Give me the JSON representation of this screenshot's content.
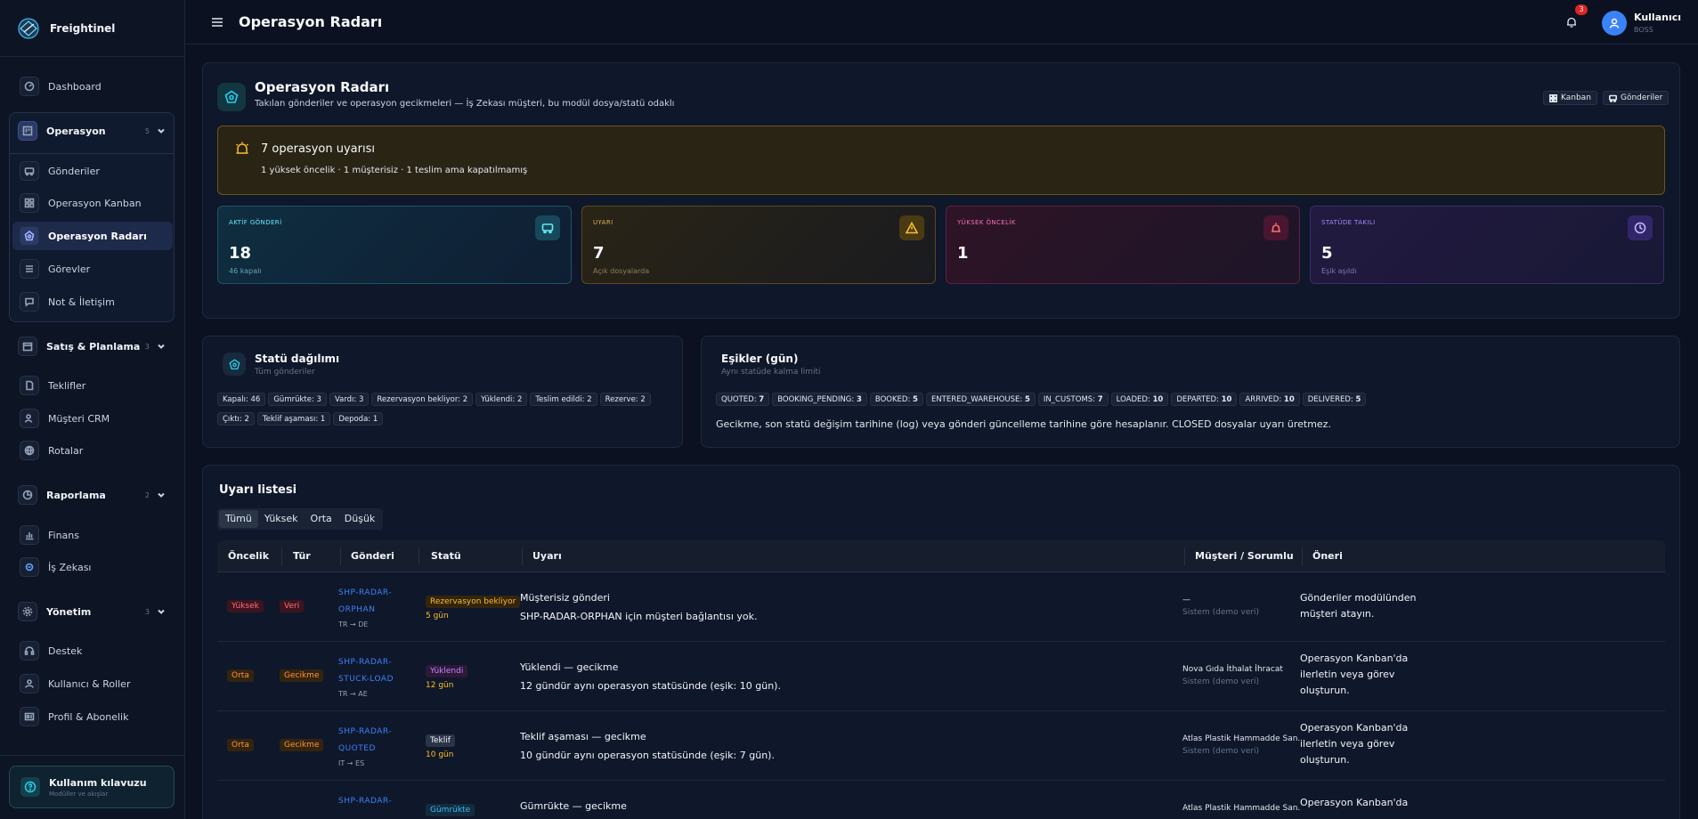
{
  "app": {
    "name": "Freightinel"
  },
  "sidebar": {
    "dashboard": "Dashboard",
    "operasyon": {
      "label": "Operasyon",
      "count": "5",
      "items": [
        "Gönderiler",
        "Operasyon Kanban",
        "Operasyon Radarı",
        "Görevler",
        "Not & İletişim"
      ]
    },
    "satis": {
      "label": "Satış & Planlama",
      "count": "3",
      "items": [
        "Teklifler",
        "Müşteri CRM",
        "Rotalar"
      ]
    },
    "raporlama": {
      "label": "Raporlama",
      "count": "2",
      "items": [
        "Finans",
        "İş Zekası"
      ]
    },
    "yonetim": {
      "label": "Yönetim",
      "count": "3",
      "items": [
        "Destek",
        "Kullanıcı & Roller",
        "Profil & Abonelik"
      ]
    },
    "guide": {
      "title": "Kullanım kılavuzu",
      "subtitle": "Modüller ve akışlar"
    }
  },
  "topbar": {
    "title": "Operasyon Radarı",
    "notifications": "3",
    "user_name": "Kullanıcı",
    "user_role": "BOSS"
  },
  "header": {
    "title": "Operasyon Radarı",
    "subtitle": "Takılan gönderiler ve operasyon gecikmeleri — İş Zekası müşteri, bu modül dosya/statü odaklı",
    "btn_kanban": "Kanban",
    "btn_gonderiler": "Gönderiler"
  },
  "alert": {
    "title": "7 operasyon uyarısı",
    "summary": "1 yüksek öncelik · 1 müşterisiz · 1 teslim ama kapatılmamış"
  },
  "stats": [
    {
      "label": "AKTİF GÖNDERİ",
      "value": "18",
      "sub": "46 kapalı"
    },
    {
      "label": "UYARI",
      "value": "7",
      "sub": "Açık dosyalarda"
    },
    {
      "label": "YÜKSEK ÖNCELİK",
      "value": "1",
      "sub": ""
    },
    {
      "label": "STATÜDE TAKILI",
      "value": "5",
      "sub": "Eşik aşıldı"
    }
  ],
  "status_dist": {
    "title": "Statü dağılımı",
    "subtitle": "Tüm gönderiler",
    "chips": [
      "Kapalı: 46",
      "Gümrükte: 3",
      "Vardı: 3",
      "Rezervasyon bekliyor: 2",
      "Yüklendi: 2",
      "Teslim edildi: 2",
      "Rezerve: 2",
      "Çıktı: 2",
      "Teklif aşaması: 1",
      "Depoda: 1"
    ]
  },
  "thresholds": {
    "title": "Eşikler (gün)",
    "subtitle": "Aynı statüde kalma limiti",
    "chips": [
      {
        "k": "QUOTED:",
        "v": "7"
      },
      {
        "k": "BOOKING_PENDING:",
        "v": "3"
      },
      {
        "k": "BOOKED:",
        "v": "5"
      },
      {
        "k": "ENTERED_WAREHOUSE:",
        "v": "5"
      },
      {
        "k": "IN_CUSTOMS:",
        "v": "7"
      },
      {
        "k": "LOADED:",
        "v": "10"
      },
      {
        "k": "DEPARTED:",
        "v": "10"
      },
      {
        "k": "ARRIVED:",
        "v": "10"
      },
      {
        "k": "DELIVERED:",
        "v": "5"
      }
    ],
    "note": "Gecikme, son statü değişim tarihine (log) veya gönderi güncelleme tarihine göre hesaplanır. CLOSED dosyalar uyarı üretmez."
  },
  "alerts_list": {
    "title": "Uyarı listesi",
    "filters": [
      "Tümü",
      "Yüksek",
      "Orta",
      "Düşük"
    ],
    "columns": [
      "Öncelik",
      "Tür",
      "Gönderi",
      "Statü",
      "Uyarı",
      "Müşteri / Sorumlu",
      "Öneri"
    ],
    "rows": [
      {
        "priority": "Yüksek",
        "type": "Veri",
        "shipment": "SHP-RADAR-ORPHAN",
        "route": "TR → DE",
        "status": "Rezervasyon bekliyor",
        "days": "5 gün",
        "title": "Müşterisiz gönderi",
        "desc": "SHP-RADAR-ORPHAN için müşteri bağlantısı yok.",
        "customer": "—",
        "owner": "Sistem (demo veri)",
        "suggestion": "Gönderiler modülünden müşteri atayın."
      },
      {
        "priority": "Orta",
        "type": "Gecikme",
        "shipment": "SHP-RADAR-STUCK-LOAD",
        "route": "TR → AE",
        "status": "Yüklendi",
        "days": "12 gün",
        "title": "Yüklendi — gecikme",
        "desc": "12 gündür aynı operasyon statüsünde (eşik: 10 gün).",
        "customer": "Nova Gıda İthalat İhracat",
        "owner": "Sistem (demo veri)",
        "suggestion": "Operasyon Kanban'da ilerletin veya görev oluşturun."
      },
      {
        "priority": "Orta",
        "type": "Gecikme",
        "shipment": "SHP-RADAR-QUOTED",
        "route": "IT → ES",
        "status": "Teklif",
        "days": "10 gün",
        "title": "Teklif aşaması — gecikme",
        "desc": "10 gündür aynı operasyon statüsünde (eşik: 7 gün).",
        "customer": "Atlas Plastik Hammadde San.",
        "owner": "Sistem (demo veri)",
        "suggestion": "Operasyon Kanban'da ilerletin veya görev oluşturun."
      },
      {
        "priority": "",
        "type": "",
        "shipment": "SHP-RADAR-",
        "route": "",
        "status": "Gümrükte",
        "days": "",
        "title": "Gümrükte — gecikme",
        "desc": "",
        "customer": "Atlas Plastik Hammadde San.",
        "owner": "",
        "suggestion": "Operasyon Kanban'da"
      }
    ]
  },
  "colors": {
    "accent": "#22d3ee",
    "warning": "#fbbf24",
    "danger": "#f87171",
    "link": "#3b82f6"
  }
}
